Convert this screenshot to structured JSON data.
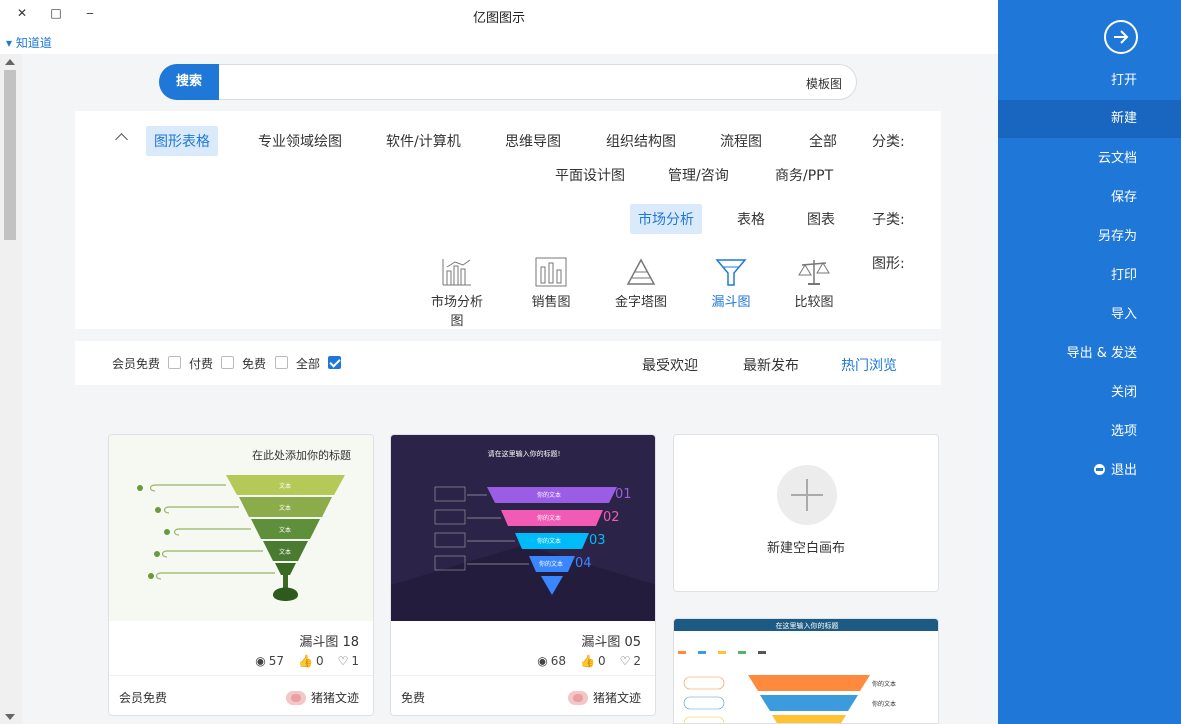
{
  "window": {
    "title": "亿图图示",
    "min": "‒",
    "max": "□",
    "close": "✕"
  },
  "sub_left": "▾ 知道道",
  "sidebar": {
    "items": [
      {
        "label": "打开"
      },
      {
        "label": "新建"
      },
      {
        "label": "云文档"
      },
      {
        "label": "保存"
      },
      {
        "label": "另存为"
      },
      {
        "label": "打印"
      },
      {
        "label": "导入"
      },
      {
        "label": "导出 & 发送"
      },
      {
        "label": "关闭"
      },
      {
        "label": "选项"
      },
      {
        "label": "退出"
      }
    ],
    "active": "新建"
  },
  "search": {
    "button": "搜索",
    "value": "模板图"
  },
  "filters": {
    "category_label": "分类:",
    "categories_row1": [
      "全部",
      "流程图",
      "组织结构图",
      "思维导图",
      "软件/计算机",
      "专业领域绘图",
      "图形表格"
    ],
    "categories_row2": [
      "商务/PPT",
      "管理/咨询",
      "平面设计图"
    ],
    "sub_label": "子类:",
    "subcategories": [
      "图表",
      "表格",
      "市场分析"
    ],
    "shape_label": "图形:",
    "shapes": [
      "比较图",
      "漏斗图",
      "金字塔图",
      "销售图",
      "市场分析图"
    ]
  },
  "sort": {
    "tabs": [
      "热门浏览",
      "最新发布",
      "最受欢迎"
    ],
    "checks": [
      "全部",
      "免费",
      "付费",
      "会员免费"
    ]
  },
  "blank_card": {
    "label": "新建空白画布"
  },
  "cards": [
    {
      "title": "漏斗图 05",
      "views": "68",
      "likes": "0",
      "favs": "2",
      "author": "猪猪文迹",
      "price": "免费",
      "thumb_title": "请在这里输入你的标题!",
      "funnel_labels": [
        "01",
        "02",
        "03",
        "04"
      ],
      "item_text": "你的文本"
    },
    {
      "title": "漏斗图 18",
      "views": "57",
      "likes": "0",
      "favs": "1",
      "author": "猪猪文迹",
      "price": "会员免费",
      "thumb_title": "在此处添加你的标题",
      "item_text": "文本"
    }
  ],
  "partial_card": {
    "thumb_title": "在这里输入你的标题",
    "item_text": "你的文本"
  },
  "colors": {
    "accent": "#1f78d8",
    "sidebar": "#1f78d8",
    "sidebar_active": "#1866bf"
  }
}
